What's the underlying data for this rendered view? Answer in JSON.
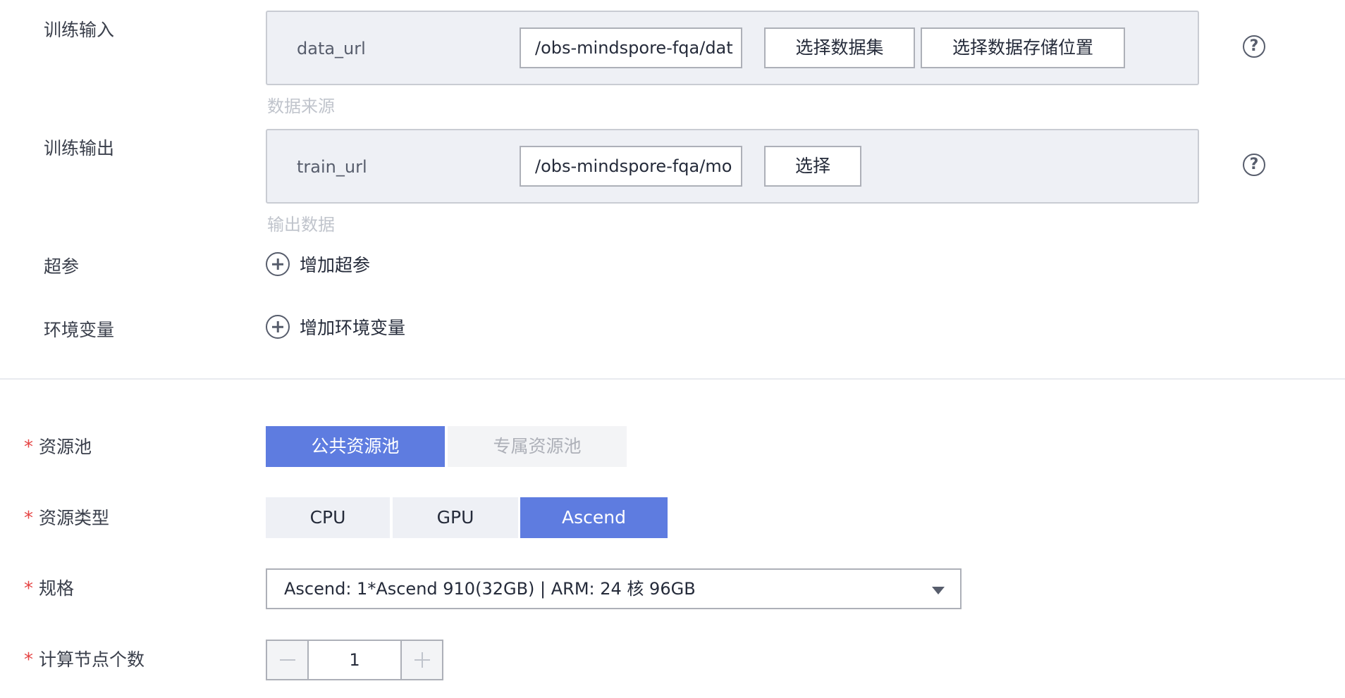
{
  "training_input": {
    "label": "训练输入",
    "param_name": "data_url",
    "path_value": "/obs-mindspore-fqa/dat",
    "select_dataset_button": "选择数据集",
    "select_storage_button": "选择数据存储位置",
    "hint": "数据来源"
  },
  "training_output": {
    "label": "训练输出",
    "param_name": "train_url",
    "path_value": "/obs-mindspore-fqa/mo",
    "select_button": "选择",
    "hint": "输出数据"
  },
  "hyperparams": {
    "label": "超参",
    "add_label": "增加超参"
  },
  "env_vars": {
    "label": "环境变量",
    "add_label": "增加环境变量"
  },
  "help_icon_glyph": "?",
  "required_mark": "*",
  "resource_pool": {
    "label": "资源池",
    "options": [
      "公共资源池",
      "专属资源池"
    ],
    "selected": "公共资源池"
  },
  "resource_type": {
    "label": "资源类型",
    "options": [
      "CPU",
      "GPU",
      "Ascend"
    ],
    "selected": "Ascend"
  },
  "spec": {
    "label": "规格",
    "value": "Ascend: 1*Ascend 910(32GB) | ARM: 24 核 96GB"
  },
  "node_count": {
    "label": "计算节点个数",
    "value": "1"
  },
  "colors": {
    "accent": "#5e7ce0",
    "required": "#e54545",
    "panel_bg": "#eef0f5"
  }
}
